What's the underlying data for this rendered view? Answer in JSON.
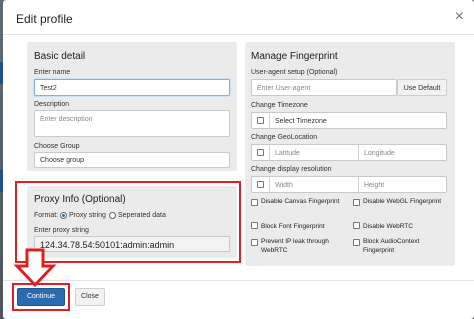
{
  "modal": {
    "title": "Edit profile"
  },
  "basic": {
    "title": "Basic detail",
    "name_label": "Enter name",
    "name_value": "Test2",
    "description_label": "Description",
    "description_placeholder": "Enter description",
    "group_label": "Choose Group",
    "group_value": "Choose group"
  },
  "proxy": {
    "title": "Proxy Info (Optional)",
    "format_label": "Format:",
    "format_options": [
      "Proxy string",
      "Seperated data"
    ],
    "string_label": "Enter proxy string",
    "string_value": "124.34.78.54:50101:admin:admin"
  },
  "fingerprint": {
    "title": "Manage Fingerprint",
    "ua_label": "User-agent setup (Optional)",
    "ua_placeholder": "Enter User-agent",
    "ua_default_button": "Use Default",
    "timezone_label": "Change Timezone",
    "timezone_placeholder": "Select Timezone",
    "geo_label": "Change GeoLocation",
    "latitude_placeholder": "Latitude",
    "longitude_placeholder": "Longitude",
    "resolution_label": "Change display resolution",
    "width_placeholder": "Width",
    "height_placeholder": "Height",
    "options": [
      "Disable Canvas Fingerprint",
      "Disable WebGL Fingerprint",
      "Block Font Fingerprint",
      "Disable WebRTC",
      "Prevent IP leak through WebRTC",
      "Block AudioContext Fingerprint"
    ]
  },
  "footer": {
    "continue_label": "Continue",
    "close_label": "Close"
  },
  "colors": {
    "primary": "#2b6cb0",
    "highlight": "#e02020"
  }
}
